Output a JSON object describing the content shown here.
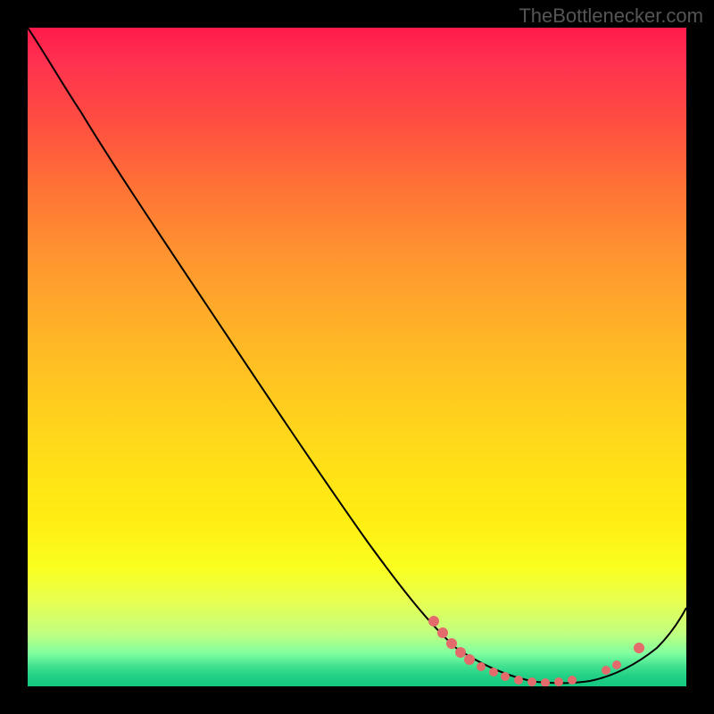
{
  "attribution": "TheBottlenecker.com",
  "chart_data": {
    "type": "line",
    "title": "",
    "xlabel": "",
    "ylabel": "",
    "xlim": [
      0,
      100
    ],
    "ylim": [
      0,
      100
    ],
    "curve": [
      {
        "x": 0,
        "y": 100
      },
      {
        "x": 6,
        "y": 92
      },
      {
        "x": 12,
        "y": 83
      },
      {
        "x": 20,
        "y": 71
      },
      {
        "x": 30,
        "y": 56
      },
      {
        "x": 40,
        "y": 41
      },
      {
        "x": 50,
        "y": 27
      },
      {
        "x": 60,
        "y": 13
      },
      {
        "x": 65,
        "y": 7
      },
      {
        "x": 70,
        "y": 3
      },
      {
        "x": 75,
        "y": 1
      },
      {
        "x": 80,
        "y": 0.5
      },
      {
        "x": 85,
        "y": 1
      },
      {
        "x": 90,
        "y": 3
      },
      {
        "x": 95,
        "y": 7
      },
      {
        "x": 100,
        "y": 12
      }
    ],
    "data_points": [
      {
        "x": 62,
        "y": 10
      },
      {
        "x": 63.5,
        "y": 8
      },
      {
        "x": 65,
        "y": 6
      },
      {
        "x": 66.5,
        "y": 4.5
      },
      {
        "x": 68,
        "y": 3.3
      },
      {
        "x": 70,
        "y": 2.2
      },
      {
        "x": 72,
        "y": 1.4
      },
      {
        "x": 74,
        "y": 0.9
      },
      {
        "x": 76,
        "y": 0.6
      },
      {
        "x": 78,
        "y": 0.5
      },
      {
        "x": 80,
        "y": 0.5
      },
      {
        "x": 82,
        "y": 0.6
      },
      {
        "x": 84,
        "y": 0.9
      },
      {
        "x": 88,
        "y": 2.5
      },
      {
        "x": 90,
        "y": 3.5
      },
      {
        "x": 93,
        "y": 6
      }
    ],
    "description": "Bottleneck curve showing optimal performance valley. The curve descends from top-left, reaches minimum around x=78-82, then rises slightly. Gradient background transitions from red (high bottleneck) at top through orange, yellow to green (optimal) at bottom."
  }
}
